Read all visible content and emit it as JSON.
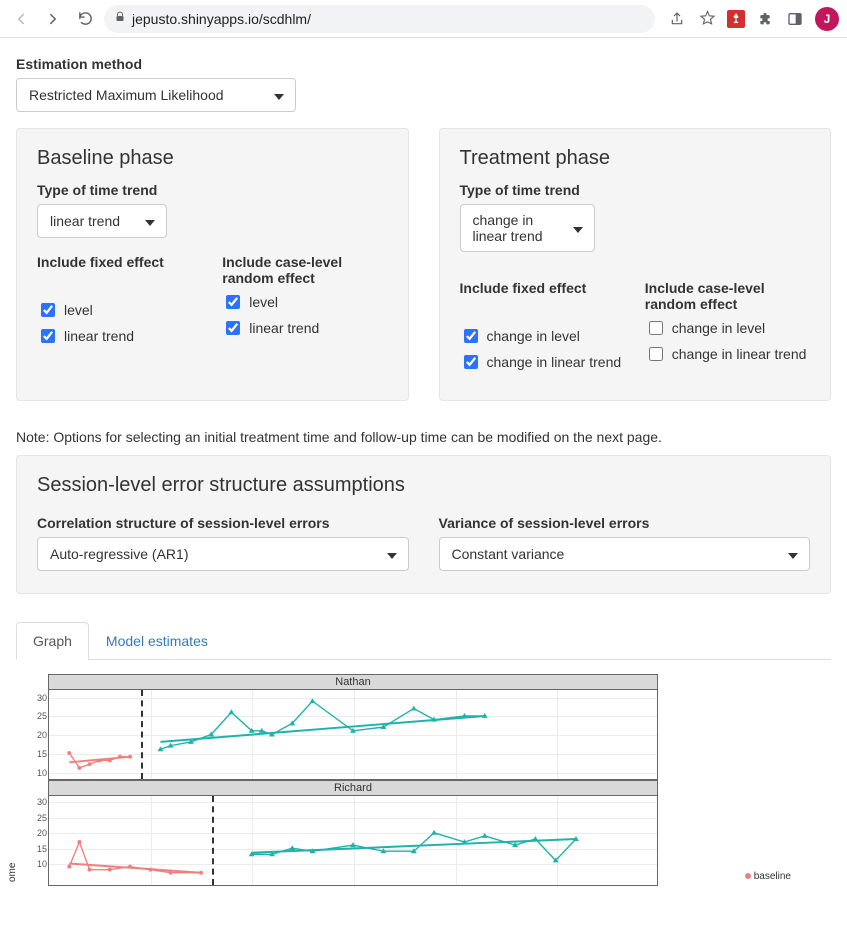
{
  "chrome": {
    "url": "jepusto.shinyapps.io/scdhlm/",
    "avatar_initial": "J"
  },
  "estimation": {
    "label": "Estimation method",
    "selected": "Restricted Maximum Likelihood"
  },
  "baseline": {
    "title": "Baseline phase",
    "trend_label": "Type of time trend",
    "trend_selected": "linear trend",
    "fixed_label": "Include fixed effect",
    "random_label": "Include case-level random effect",
    "cb_level": "level",
    "cb_linear": "linear trend"
  },
  "treatment": {
    "title": "Treatment phase",
    "trend_label": "Type of time trend",
    "trend_selected": "change in linear trend",
    "fixed_label": "Include fixed effect",
    "random_label": "Include case-level random effect",
    "cb_change_level": "change in level",
    "cb_change_linear": "change in linear trend"
  },
  "note": "Note: Options for selecting an initial treatment time and follow-up time can be modified on the next page.",
  "errors": {
    "title": "Session-level error structure assumptions",
    "corr_label": "Correlation structure of session-level errors",
    "corr_selected": "Auto-regressive (AR1)",
    "var_label": "Variance of session-level errors",
    "var_selected": "Constant variance"
  },
  "tabs": {
    "graph": "Graph",
    "estimates": "Model estimates"
  },
  "chart_data": [
    {
      "type": "line",
      "title": "Nathan",
      "ylabel": "ome",
      "ylim": [
        8,
        32
      ],
      "yticks": [
        10,
        15,
        20,
        25,
        30
      ],
      "xlim": [
        0,
        60
      ],
      "phase_boundary_x": 9,
      "series": [
        {
          "name": "baseline",
          "color": "#f08080",
          "x": [
            2,
            3,
            4,
            5,
            6,
            7,
            8
          ],
          "values": [
            15,
            11,
            12,
            13,
            13,
            14,
            14
          ],
          "fit": {
            "x": [
              2,
              8
            ],
            "y": [
              12.5,
              14
            ]
          }
        },
        {
          "name": "treatment",
          "color": "#20b2aa",
          "x": [
            11,
            12,
            14,
            16,
            18,
            20,
            21,
            22,
            24,
            26,
            30,
            33,
            36,
            38,
            41,
            43
          ],
          "values": [
            16,
            17,
            18,
            20,
            26,
            21,
            21,
            20,
            23,
            29,
            21,
            22,
            27,
            24,
            25,
            25
          ],
          "fit": {
            "x": [
              11,
              43
            ],
            "y": [
              18,
              25
            ]
          }
        }
      ]
    },
    {
      "type": "line",
      "title": "Richard",
      "ylabel": "ome",
      "ylim": [
        3,
        32
      ],
      "yticks": [
        10,
        15,
        20,
        25,
        30
      ],
      "xlim": [
        0,
        60
      ],
      "phase_boundary_x": 16,
      "series": [
        {
          "name": "baseline",
          "color": "#f08080",
          "x": [
            2,
            3,
            4,
            6,
            8,
            10,
            12,
            15
          ],
          "values": [
            9,
            17,
            8,
            8,
            9,
            8,
            7,
            7
          ],
          "fit": {
            "x": [
              2,
              15
            ],
            "y": [
              10,
              7
            ]
          }
        },
        {
          "name": "treatment",
          "color": "#20b2aa",
          "x": [
            20,
            22,
            24,
            26,
            30,
            33,
            36,
            38,
            41,
            43,
            46,
            48,
            50,
            52
          ],
          "values": [
            13,
            13,
            15,
            14,
            16,
            14,
            14,
            20,
            17,
            19,
            16,
            18,
            11,
            18
          ],
          "fit": {
            "x": [
              20,
              52
            ],
            "y": [
              13.5,
              18
            ]
          }
        }
      ]
    }
  ],
  "legend": {
    "baseline": "baseline"
  }
}
